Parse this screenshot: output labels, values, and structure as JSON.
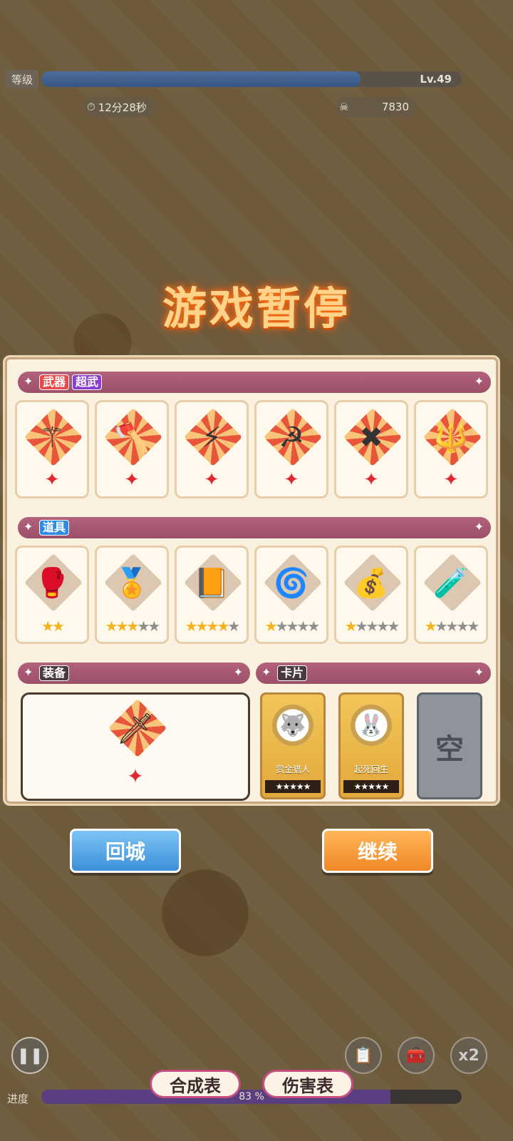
{
  "hud": {
    "level_label": "等级",
    "level_text": "Lv.49",
    "level_progress": 0.76,
    "timer": "12分28秒",
    "kills": "7830"
  },
  "title": "游戏暂停",
  "sections": {
    "weapons_tag1": "武器",
    "weapons_tag2": "超武",
    "items_tag": "道具",
    "equip_tag": "装备",
    "cards_tag": "卡片"
  },
  "weapons": [
    {
      "icon": "scepter-icon"
    },
    {
      "icon": "axe-icon"
    },
    {
      "icon": "lightning-staff-icon"
    },
    {
      "icon": "scythe-icon"
    },
    {
      "icon": "cross-blade-icon"
    },
    {
      "icon": "spear-icon"
    }
  ],
  "items": [
    {
      "icon": "bracer-icon",
      "stars_filled": 2,
      "stars_total": 2
    },
    {
      "icon": "winged-amulet-icon",
      "stars_filled": 3,
      "stars_total": 5
    },
    {
      "icon": "fire-tome-icon",
      "stars_filled": 4,
      "stars_total": 5
    },
    {
      "icon": "vortex-icon",
      "stars_filled": 1,
      "stars_total": 5
    },
    {
      "icon": "gold-bag-icon",
      "stars_filled": 1,
      "stars_total": 5
    },
    {
      "icon": "potion-icon",
      "stars_filled": 1,
      "stars_total": 5
    }
  ],
  "equipment": {
    "icon": "machete-icon"
  },
  "cards": [
    {
      "name": "赏金猎人",
      "icon": "wolf-icon",
      "stars": "★★★★★"
    },
    {
      "name": "起死回生",
      "icon": "rabbit-icon",
      "stars": "★★★★★"
    },
    {
      "empty_text": "空"
    }
  ],
  "buttons": {
    "return": "回城",
    "continue": "继续",
    "recipes": "合成表",
    "damage": "伤害表",
    "speed": "x2"
  },
  "progress": {
    "label": "进度",
    "value": 0.83,
    "text": "83 %"
  }
}
